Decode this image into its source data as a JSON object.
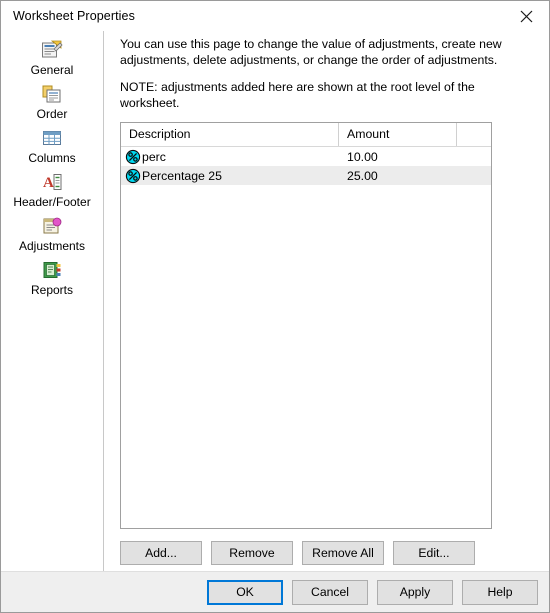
{
  "window": {
    "title": "Worksheet Properties",
    "close_icon": "close-icon"
  },
  "sidebar": {
    "items": [
      {
        "label": "General",
        "icon": "general-icon"
      },
      {
        "label": "Order",
        "icon": "order-icon"
      },
      {
        "label": "Columns",
        "icon": "columns-icon"
      },
      {
        "label": "Header/Footer",
        "icon": "header-footer-icon"
      },
      {
        "label": "Adjustments",
        "icon": "adjustments-icon"
      },
      {
        "label": "Reports",
        "icon": "reports-icon"
      }
    ]
  },
  "content": {
    "description_line1": "You can use this page to change the value of adjustments, create new",
    "description_line2": "adjustments, delete adjustments, or change the order of adjustments.",
    "note": "NOTE: adjustments added here are shown at the root level of the worksheet."
  },
  "list": {
    "columns": [
      "Description",
      "Amount"
    ],
    "rows": [
      {
        "icon": "percent-icon",
        "description": "perc",
        "amount": "10.00",
        "selected": false
      },
      {
        "icon": "percent-icon",
        "description": "Percentage 25",
        "amount": "25.00",
        "selected": true
      }
    ]
  },
  "order_buttons": [
    {
      "name": "move-to-top-button",
      "icon": "arrow-to-top-icon",
      "enabled": true
    },
    {
      "name": "move-up-button",
      "icon": "arrow-up-icon",
      "enabled": true
    },
    {
      "name": "move-down-button",
      "icon": "arrow-down-icon",
      "enabled": false
    },
    {
      "name": "move-to-bottom-button",
      "icon": "arrow-to-bottom-icon",
      "enabled": false
    }
  ],
  "list_actions": [
    {
      "label": "Add...",
      "name": "add-button"
    },
    {
      "label": "Remove",
      "name": "remove-button"
    },
    {
      "label": "Remove All",
      "name": "remove-all-button"
    },
    {
      "label": "Edit...",
      "name": "edit-button"
    }
  ],
  "footer_buttons": [
    {
      "label": "OK",
      "name": "ok-button",
      "default": true
    },
    {
      "label": "Cancel",
      "name": "cancel-button",
      "default": false
    },
    {
      "label": "Apply",
      "name": "apply-button",
      "default": false
    },
    {
      "label": "Help",
      "name": "help-button",
      "default": false
    }
  ],
  "colors": {
    "accent": "#0078d7",
    "percent_icon": "#00d8f0",
    "selection": "#ececec",
    "button_face": "#e1e1e1",
    "footer_bg": "#efefef"
  }
}
